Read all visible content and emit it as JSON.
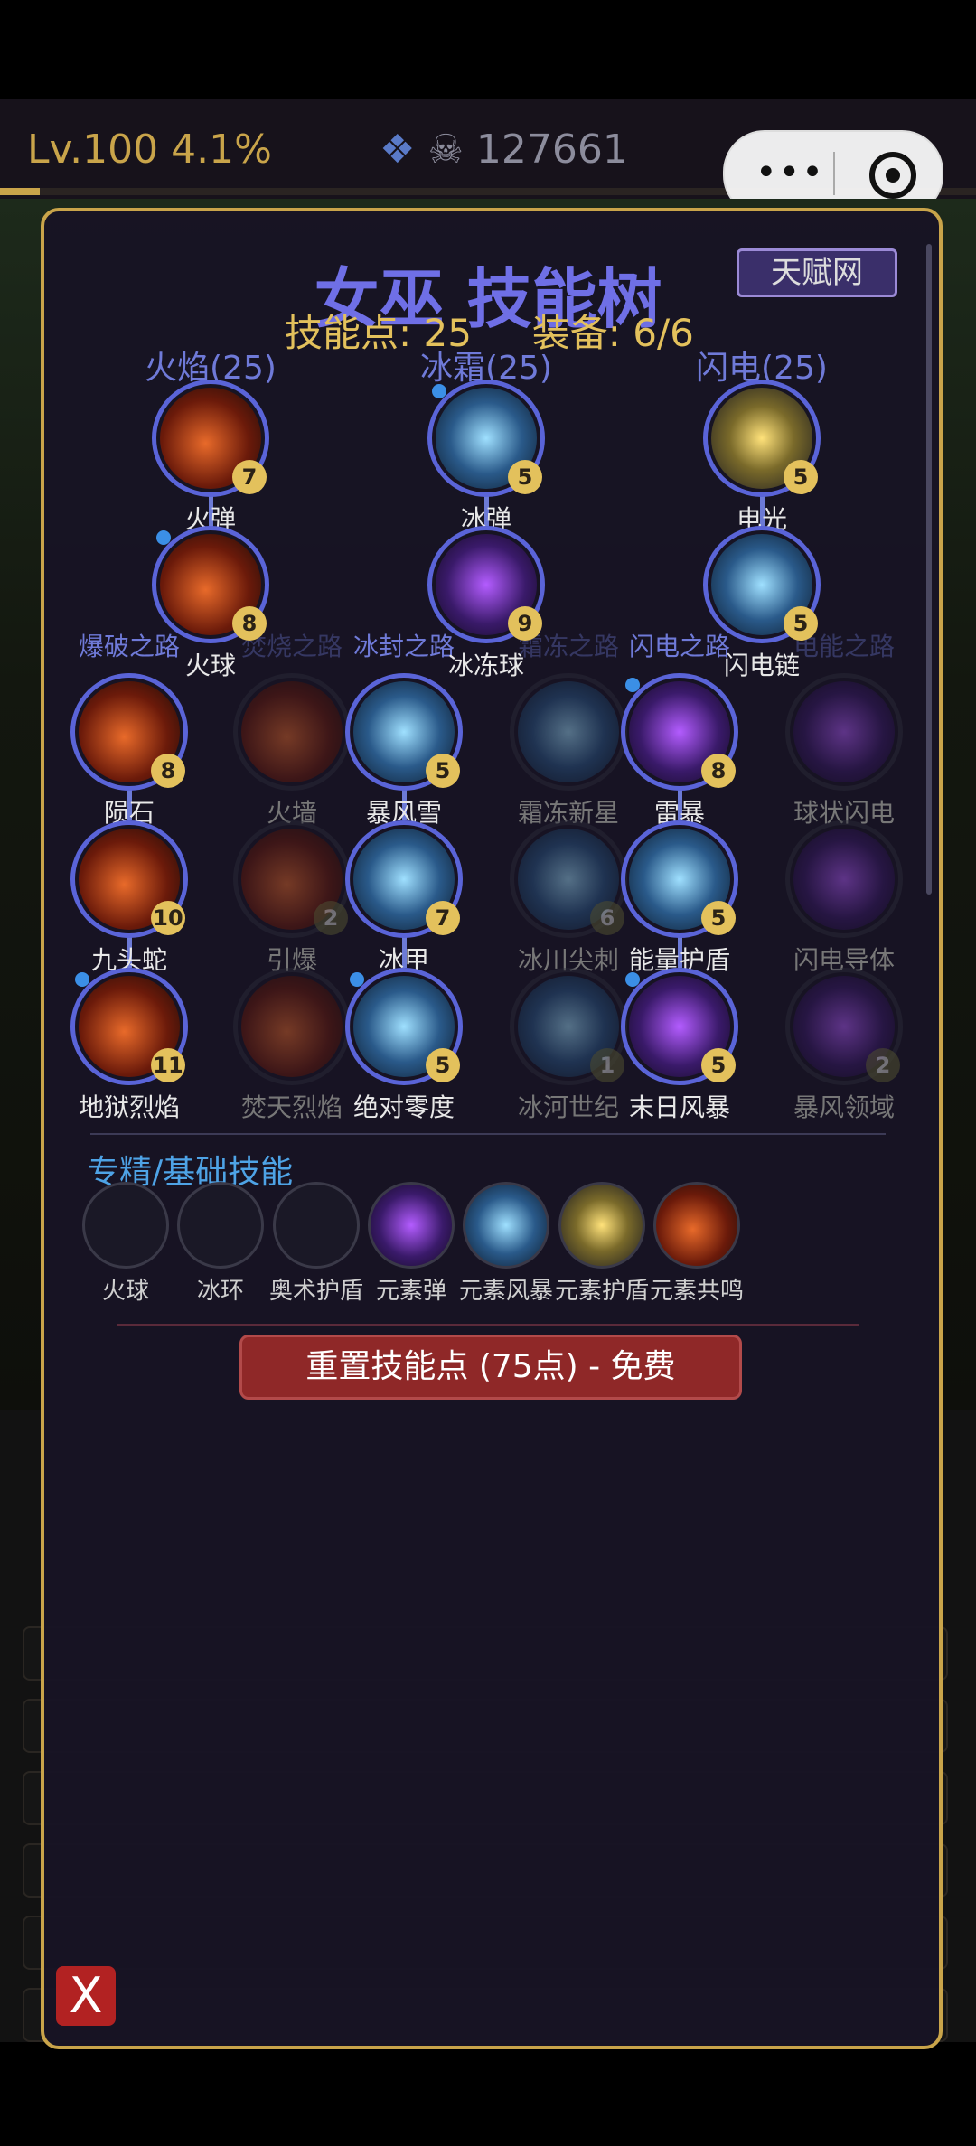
{
  "status_bar": {
    "level": "Lv.100 4.1%",
    "level_progress": 0.041,
    "gold": "127661"
  },
  "modal": {
    "title": "女巫 技能树",
    "talent_button": "天赋网",
    "skill_points": "技能点: 25",
    "equipped": "装备: 6/6",
    "columns": [
      "火焰(25)",
      "冰霜(25)",
      "闪电(25)"
    ],
    "paths": [
      "爆破之路",
      "焚烧之路",
      "冰封之路",
      "霜冻之路",
      "闪电之路",
      "电能之路"
    ],
    "row1": [
      {
        "name": "火弹",
        "level": "7"
      },
      {
        "name": "冰弹",
        "level": "5"
      },
      {
        "name": "电光",
        "level": "5"
      }
    ],
    "row2": [
      {
        "name": "火球",
        "level": "8"
      },
      {
        "name": "冰冻球",
        "level": "9"
      },
      {
        "name": "闪电链",
        "level": "5"
      }
    ],
    "row3": [
      {
        "name": "陨石",
        "level": "8"
      },
      {
        "name": "火墙",
        "level": ""
      },
      {
        "name": "暴风雪",
        "level": "5"
      },
      {
        "name": "霜冻新星",
        "level": ""
      },
      {
        "name": "雷暴",
        "level": "8"
      },
      {
        "name": "球状闪电",
        "level": ""
      }
    ],
    "row4": [
      {
        "name": "九头蛇",
        "level": "10"
      },
      {
        "name": "引爆",
        "level": "2"
      },
      {
        "name": "冰甲",
        "level": "7"
      },
      {
        "name": "冰川尖刺",
        "level": "6"
      },
      {
        "name": "能量护盾",
        "level": "5"
      },
      {
        "name": "闪电导体",
        "level": ""
      }
    ],
    "row5": [
      {
        "name": "地狱烈焰",
        "level": "11"
      },
      {
        "name": "焚天烈焰",
        "level": ""
      },
      {
        "name": "绝对零度",
        "level": "5"
      },
      {
        "name": "冰河世纪",
        "level": "1"
      },
      {
        "name": "末日风暴",
        "level": "5"
      },
      {
        "name": "暴风领域",
        "level": "2"
      }
    ],
    "section_title": "专精/基础技能",
    "base_skills": [
      "火球",
      "冰环",
      "奥术护盾",
      "元素弹",
      "元素风暴",
      "元素护盾",
      "元素共鸣"
    ],
    "reset_button": "重置技能点 (75点) - 免费",
    "close_button": "X"
  },
  "colors": {
    "accent": "#6f6fe6",
    "gold": "#e3c15c",
    "frame": "#c9a44a",
    "reset": "#8f2828"
  }
}
